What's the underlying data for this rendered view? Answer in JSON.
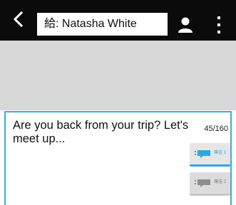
{
  "header": {
    "recipient_value": "給: Natasha White",
    "icons": {
      "back": "back-arrow-icon",
      "contact": "person-icon",
      "overflow": "more-vertical-icon"
    }
  },
  "compose": {
    "message_text": "Are you back from your trip? Let's meet up...",
    "char_count": "45/160",
    "send_buttons": [
      {
        "label": "傳送 1",
        "icon": "send-message-icon"
      },
      {
        "label": "傳送 2",
        "icon": "send-message-icon"
      }
    ]
  },
  "colors": {
    "topbar": "#0b0b0b",
    "accent": "#3fa9e0",
    "conversation_bg": "#d8d8d8"
  }
}
